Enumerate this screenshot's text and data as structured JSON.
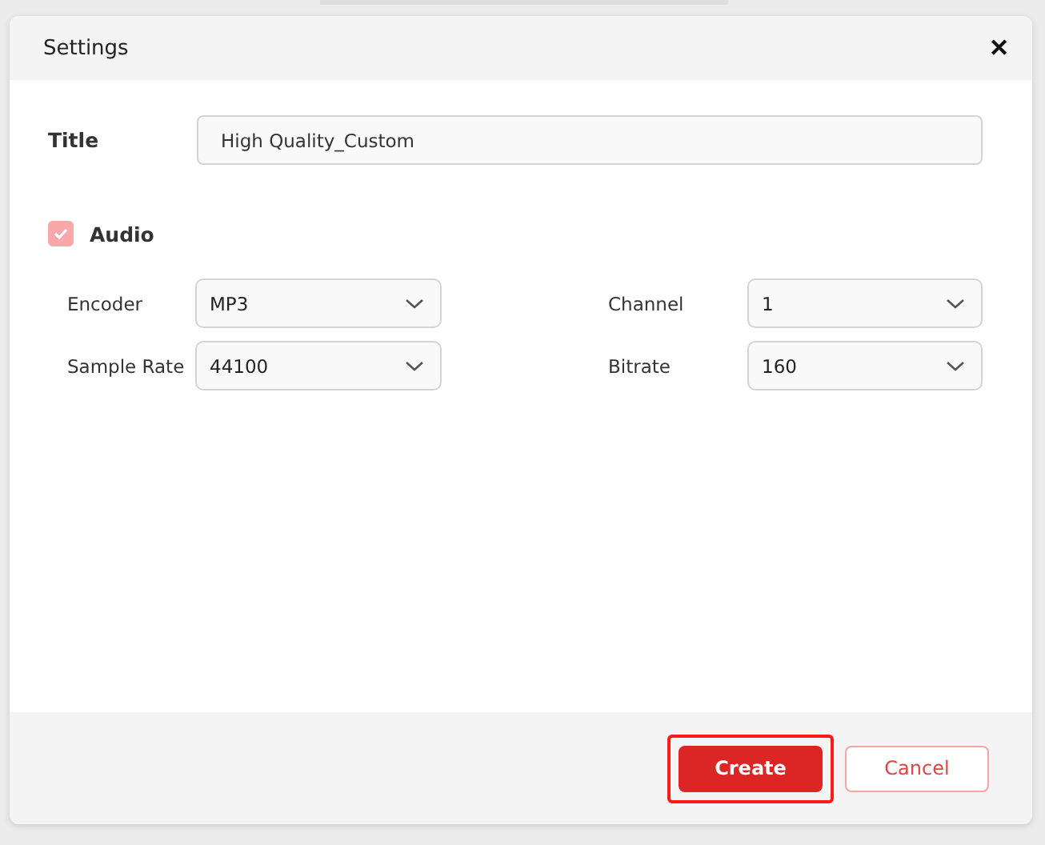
{
  "dialog": {
    "title": "Settings",
    "close": "✕"
  },
  "title_field": {
    "label": "Title",
    "value": "High Quality_Custom"
  },
  "audio": {
    "label": "Audio",
    "checked": true
  },
  "selects": [
    {
      "label": "Encoder",
      "value": "MP3"
    },
    {
      "label": "Channel",
      "value": "1"
    },
    {
      "label": "Sample Rate",
      "value": "44100"
    },
    {
      "label": "Bitrate",
      "value": "160"
    }
  ],
  "buttons": [
    {
      "label": "Create",
      "kind": "primary",
      "highlighted": true
    },
    {
      "label": "Cancel",
      "kind": "secondary",
      "highlighted": false
    }
  ]
}
